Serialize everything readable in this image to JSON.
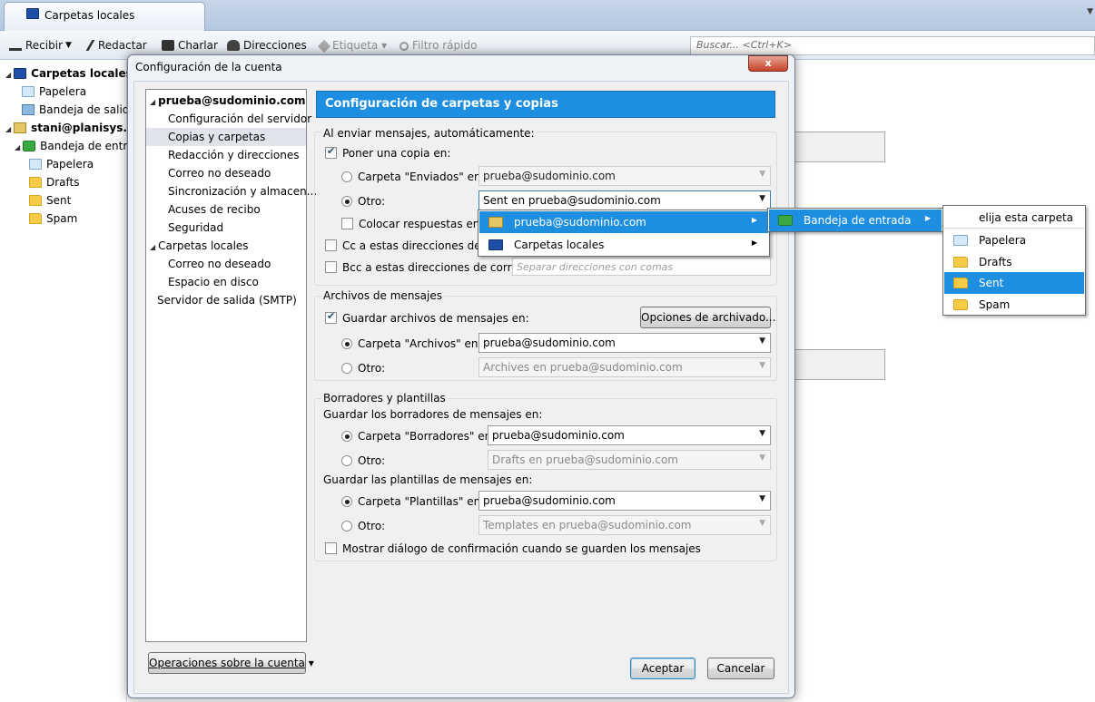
{
  "tab": {
    "title": "Carpetas locales"
  },
  "toolbar": {
    "recibir": "Recibir",
    "redactar": "Redactar",
    "charlar": "Charlar",
    "direcciones": "Direcciones",
    "etiqueta": "Etiqueta",
    "filtro": "Filtro rápido",
    "search_placeholder": "Buscar... <Ctrl+K>"
  },
  "folders": {
    "local": "Carpetas locales",
    "papelera": "Papelera",
    "bandeja_salida": "Bandeja de salida",
    "account": "stani@planisys.com",
    "bandeja_entrada": "Bandeja de entrada",
    "papelera2": "Papelera",
    "drafts": "Drafts",
    "sent": "Sent",
    "spam": "Spam"
  },
  "dialog": {
    "title": "Configuración de la cuenta",
    "close": "x",
    "tree": {
      "account": "prueba@sudominio.com",
      "items": [
        "Configuración del servidor",
        "Copias y carpetas",
        "Redacción y direcciones",
        "Correo no deseado",
        "Sincronización y almacen...",
        "Acuses de recibo",
        "Seguridad"
      ],
      "local": "Carpetas locales",
      "local_items": [
        "Correo no deseado",
        "Espacio en disco"
      ],
      "smtp": "Servidor de salida (SMTP)"
    },
    "ops_button": "Operaciones sobre la cuenta",
    "header": "Configuración de carpetas y copias",
    "sending": {
      "legend": "Al enviar mensajes, automáticamente:",
      "copy": "Poner una copia en:",
      "enviados": "Carpeta \"Enviados\" en:",
      "enviados_value": "prueba@sudominio.com",
      "otro": "Otro:",
      "otro_value": "Sent en prueba@sudominio.com",
      "respuestas": "Colocar respuestas en la",
      "cc": "Cc a estas direcciones de cor",
      "bcc": "Bcc a estas direcciones de correo:",
      "bcc_placeholder": "Separar direcciones con comas"
    },
    "archives": {
      "legend": "Archivos de mensajes",
      "save": "Guardar archivos de mensajes en:",
      "options": "Opciones de archivado...",
      "carpeta": "Carpeta \"Archivos\" en:",
      "carpeta_value": "prueba@sudominio.com",
      "otro": "Otro:",
      "otro_value": "Archives en prueba@sudominio.com"
    },
    "drafts": {
      "legend": "Borradores y plantillas",
      "save_drafts": "Guardar los borradores de mensajes en:",
      "carpeta": "Carpeta \"Borradores\" en:",
      "carpeta_value": "prueba@sudominio.com",
      "otro": "Otro:",
      "otro_value": "Drafts en prueba@sudominio.com",
      "save_templates": "Guardar las plantillas de mensajes en:",
      "plantillas": "Carpeta \"Plantillas\" en:",
      "plantillas_value": "prueba@sudominio.com",
      "otro2": "Otro:",
      "otro2_value": "Templates en prueba@sudominio.com",
      "confirm": "Mostrar diálogo de confirmación cuando se guarden los mensajes"
    },
    "accept": "Aceptar",
    "cancel": "Cancelar"
  },
  "menu1": [
    "prueba@sudominio.com",
    "Carpetas locales"
  ],
  "menu2": [
    "Bandeja de entrada"
  ],
  "menu3": [
    "elija esta carpeta",
    "Papelera",
    "Drafts",
    "Sent",
    "Spam"
  ],
  "colors": {
    "accent": "#1e8fe0",
    "highlight": "#1e8fe0"
  }
}
